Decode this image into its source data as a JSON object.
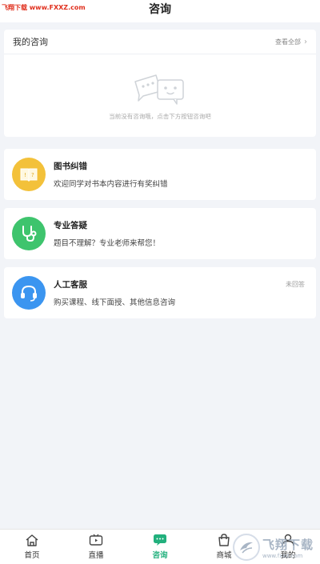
{
  "watermark_top": "飞翔下载 www.FXXZ.com",
  "page_title": "咨询",
  "my_consult": {
    "title": "我的咨询",
    "view_all": "查看全部",
    "empty_text": "当前没有咨询哦，点击下方按钮咨询吧"
  },
  "services": [
    {
      "name": "图书纠错",
      "desc": "欢迎同学对书本内容进行有奖纠错",
      "icon": "book-icon",
      "color": "#f3c13a",
      "status": ""
    },
    {
      "name": "专业答疑",
      "desc": "题目不理解？专业老师来帮您！",
      "icon": "stethoscope-icon",
      "color": "#3ec46d",
      "status": ""
    },
    {
      "name": "人工客服",
      "desc": "购买课程、线下面授、其他信息咨询",
      "icon": "headset-icon",
      "color": "#3b95f0",
      "status": "未回答"
    }
  ],
  "tabs": [
    {
      "label": "首页",
      "icon": "home-icon"
    },
    {
      "label": "直播",
      "icon": "tv-icon"
    },
    {
      "label": "咨询",
      "icon": "chat-icon",
      "active": true
    },
    {
      "label": "商城",
      "icon": "shop-icon"
    },
    {
      "label": "我的",
      "icon": "user-icon"
    }
  ],
  "watermark_brand": {
    "name": "飞翔下载",
    "url": "www.fxxz.com"
  },
  "colors": {
    "accent": "#22b07d",
    "background": "#f2f4f8"
  }
}
